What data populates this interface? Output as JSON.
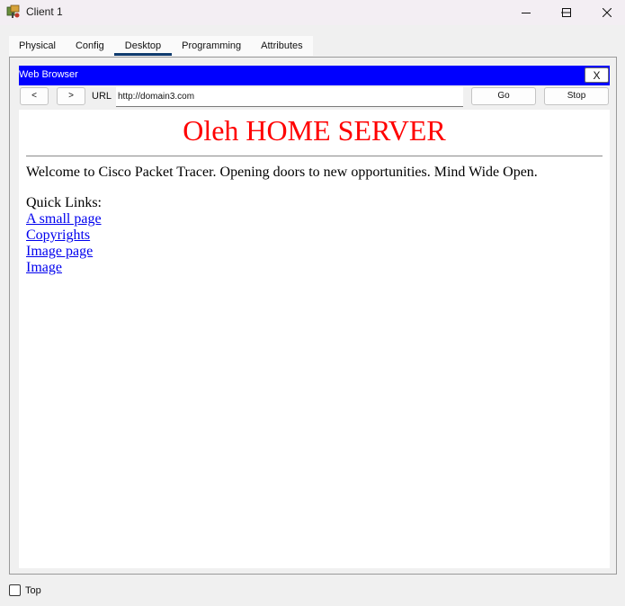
{
  "window": {
    "title": "Client 1",
    "icon": "packet-tracer-client-icon",
    "controls": [
      "minimize-icon",
      "maximize-icon",
      "close-icon"
    ]
  },
  "tabs": [
    {
      "label": "Physical",
      "active": false
    },
    {
      "label": "Config",
      "active": false
    },
    {
      "label": "Desktop",
      "active": true
    },
    {
      "label": "Programming",
      "active": false
    },
    {
      "label": "Attributes",
      "active": false
    }
  ],
  "browser": {
    "title": "Web Browser",
    "close_label": "X",
    "title_bar_color": "#0000ff",
    "back_label": "<",
    "forward_label": ">",
    "url_label": "URL",
    "url_value": "http://domain3.com",
    "go_label": "Go",
    "stop_label": "Stop"
  },
  "page": {
    "heading": "Oleh HOME SERVER",
    "heading_color": "#ff0000",
    "welcome": "Welcome to Cisco Packet Tracer. Opening doors to new opportunities. Mind Wide Open.",
    "quick_links_heading": "Quick Links:",
    "links": [
      "A small page",
      "Copyrights",
      "Image page",
      "Image"
    ]
  },
  "footer": {
    "top_checkbox_label": "Top",
    "top_checked": false
  }
}
